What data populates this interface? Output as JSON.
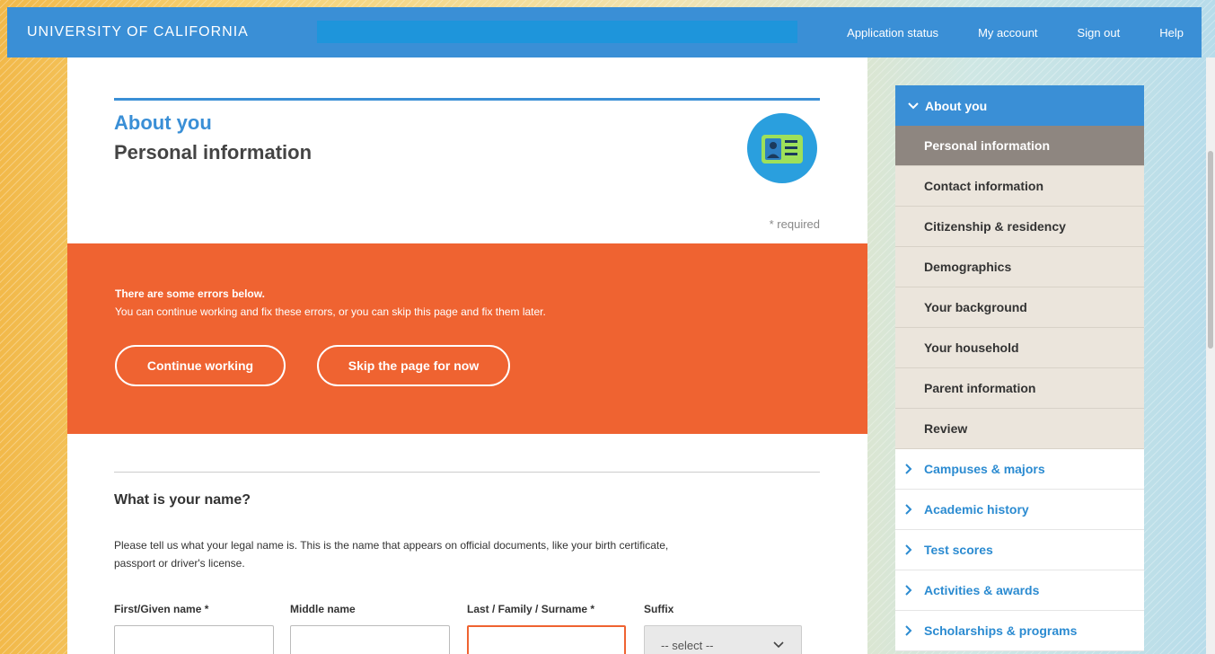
{
  "topbar": {
    "brand": "UNIVERSITY OF CALIFORNIA",
    "nav": [
      "Application status",
      "My account",
      "Sign out",
      "Help"
    ]
  },
  "main": {
    "section_title": "About you",
    "page_title": "Personal information",
    "badge_icon": "id-card-icon",
    "required_note": "* required",
    "errors": {
      "heading": "There are some errors below.",
      "message": "You can continue working and fix these errors, or you can skip this page and fix them later.",
      "continue_label": "Continue working",
      "skip_label": "Skip the page for now"
    },
    "name_question": "What is your name?",
    "name_description": "Please tell us what your legal name is. This is the name that appears on official documents, like your birth certificate, passport or driver's license.",
    "fields": {
      "first_label": "First/Given name *",
      "middle_label": "Middle name",
      "last_label": "Last / Family / Surname *",
      "suffix_label": "Suffix",
      "suffix_value": "-- select --"
    }
  },
  "sidebar": {
    "current_section": "About you",
    "items": [
      "Personal information",
      "Contact information",
      "Citizenship & residency",
      "Demographics",
      "Your background",
      "Your household",
      "Parent information",
      "Review"
    ],
    "sections": [
      "Campuses & majors",
      "Academic history",
      "Test scores",
      "Activities & awards",
      "Scholarships & programs"
    ]
  },
  "colors": {
    "primary_blue": "#3a8fd6",
    "error_orange": "#ef6331",
    "active_item": "#8e8680"
  }
}
